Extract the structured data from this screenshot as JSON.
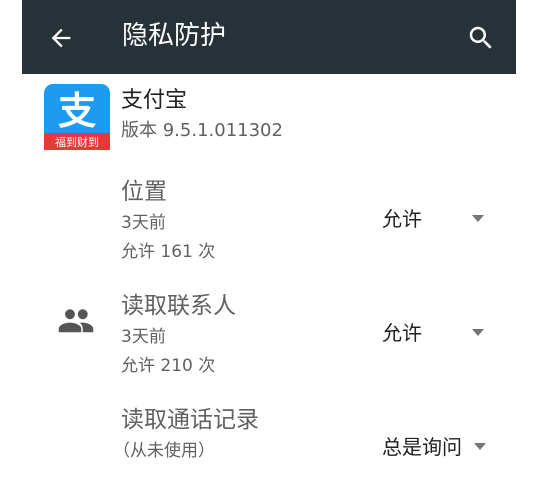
{
  "header": {
    "title": "隐私防护",
    "back_icon": "arrow-left-icon",
    "search_icon": "search-icon",
    "bg_color": "#263238"
  },
  "app": {
    "name": "支付宝",
    "version": "版本 9.5.1.011302",
    "icon_glyph": "支",
    "icon_banner": "福到财到",
    "icon_color": "#1C9BEF",
    "banner_color": "#E53935"
  },
  "permissions": [
    {
      "title": "位置",
      "last_used": "3天前",
      "count": "允许 161 次",
      "setting": "允许"
    },
    {
      "icon": "contacts-icon",
      "title": "读取联系人",
      "last_used": "3天前",
      "count": "允许 210 次",
      "setting": "允许"
    },
    {
      "title": "读取通话记录",
      "last_used": "（从未使用）",
      "setting": "总是询问"
    }
  ]
}
